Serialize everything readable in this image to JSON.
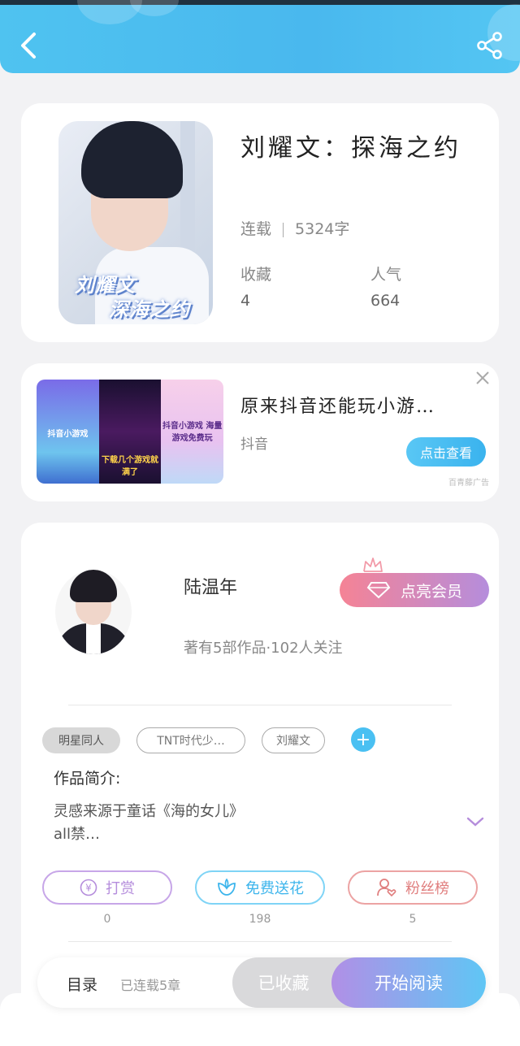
{
  "book": {
    "title": "刘耀文：探海之约",
    "status": "连载",
    "word_count": "5324字",
    "fav_label": "收藏",
    "fav_value": "4",
    "pop_label": "人气",
    "pop_value": "664",
    "cover_text_line1": "刘耀文",
    "cover_text_line2": "深海之约"
  },
  "ad": {
    "title": "原来抖音还能玩小游…",
    "source": "抖音",
    "cta": "点击查看",
    "tag": "百青藤广告",
    "thumb1_text": "抖音小游戏",
    "thumb2_text": "下载几个游戏就满了",
    "thumb3_text": "抖音小游戏 海量游戏免费玩"
  },
  "author": {
    "name": "陆温年",
    "info": "著有5部作品·102人关注",
    "vip_label": "点亮会员",
    "tags": [
      "明星同人",
      "TNT时代少…",
      "刘耀文"
    ],
    "intro_label": "作品简介:",
    "intro_line1": "灵感来源于童话《海的女儿》",
    "intro_line2": "all禁…"
  },
  "actions": {
    "reward_label": "打赏",
    "reward_value": "0",
    "flower_label": "免费送花",
    "flower_value": "198",
    "fans_label": "粉丝榜",
    "fans_value": "5"
  },
  "bottom": {
    "toc_label": "目录",
    "toc_info": "已连载5章",
    "fav_button": "已收藏",
    "read_button": "开始阅读"
  },
  "colors": {
    "header": "#4fc3f0",
    "accent_blue": "#4ac0f2",
    "reward": "#b58ddc",
    "flower": "#59c7f5",
    "fans": "#e98a8a"
  }
}
